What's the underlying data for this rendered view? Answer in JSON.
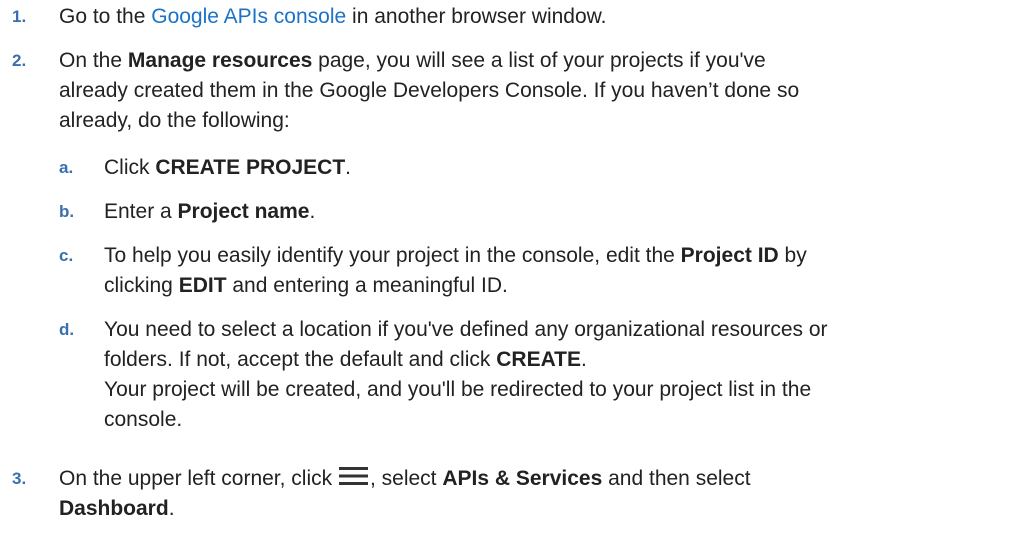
{
  "steps": {
    "s1": {
      "num": "1.",
      "pre": "Go to the ",
      "link": "Google APIs console",
      "post": " in another browser window."
    },
    "s2": {
      "num": "2.",
      "pre": "On the ",
      "bold": "Manage resources",
      "line1_rest": " page, you will see a list of your projects if you've",
      "line2": "already created them in the Google Developers Console. If you haven’t done so",
      "line3": "already, do the following:",
      "subs": {
        "a": {
          "num": "a.",
          "pre": "Click ",
          "bold": "CREATE PROJECT",
          "post": "."
        },
        "b": {
          "num": "b.",
          "pre": "Enter a ",
          "bold": "Project name",
          "post": "."
        },
        "c": {
          "num": "c.",
          "pre": "To help you easily identify your project in the console, edit the ",
          "bold1": "Project ID",
          "mid": " by",
          "line2_pre": "clicking ",
          "bold2": "EDIT",
          "post": " and entering a meaningful ID."
        },
        "d": {
          "num": "d.",
          "line1": "You need to select a location if you've defined any organizational resources or",
          "line2_pre": "folders. If not, accept the default and click ",
          "bold": "CREATE",
          "line2_post": ".",
          "line3": "Your project will be created, and you'll be redirected to your project list in the",
          "line4": "console."
        }
      }
    },
    "s3": {
      "num": "3.",
      "pre": "On the upper left corner, click ",
      "icon": "hamburger-menu-icon",
      "mid": ", select ",
      "bold1": "APIs & Services",
      "post": " and then select",
      "bold2": "Dashboard",
      "end": "."
    }
  },
  "colors": {
    "step_number": "#3a6fb0",
    "link": "#1a73c8",
    "text": "#222222"
  }
}
